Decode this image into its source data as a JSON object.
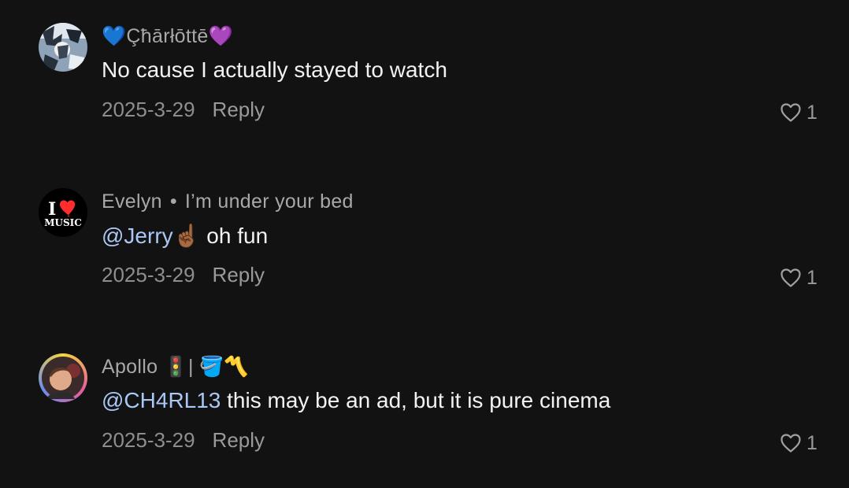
{
  "comments": [
    {
      "username": "💙Çħārłōttē💜",
      "subtitle": "",
      "mention": "",
      "text": "No cause I actually stayed to watch",
      "date": "2025-3-29",
      "reply_label": "Reply",
      "likes": "1"
    },
    {
      "username": "Evelyn",
      "subtitle": "I’m under  your  bed",
      "mention": "@Jerry☝🏾",
      "text": " oh fun",
      "date": "2025-3-29",
      "reply_label": "Reply",
      "likes": "1"
    },
    {
      "username": "Apollo 🚦| 🪣〽️",
      "subtitle": "",
      "mention": "@CH4RL13",
      "text": " this may be an ad, but it is pure cinema",
      "date": "2025-3-29",
      "reply_label": "Reply",
      "likes": "1"
    }
  ],
  "avatar2_text": {
    "top": "I",
    "bottom": "MUSIC"
  },
  "colors": {
    "background": "#121212",
    "mention": "#a9c8f5",
    "heart": "#ff2d2d"
  }
}
